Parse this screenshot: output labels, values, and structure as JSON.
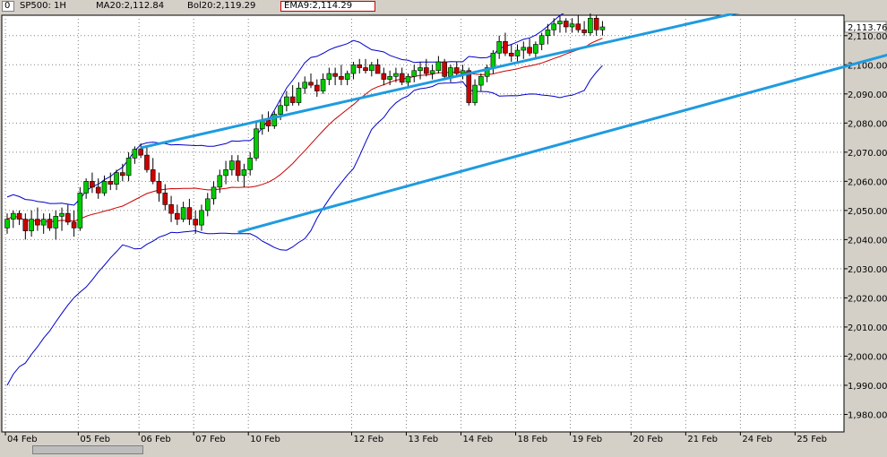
{
  "header": {
    "symbol_box": "0",
    "symbol": "SP500: 1H",
    "ma": "MA20:2,112.84",
    "bol": "Bol20:2,119.29",
    "ema": "EMA9:2,114.29",
    "last_price_label": "2,113.76"
  },
  "colors": {
    "up": "#00cc00",
    "down": "#cc0000",
    "band": "#0000cc",
    "ma": "#cc0000",
    "channel": "#1e9be0",
    "grid": "#808080",
    "bg": "#ffffff",
    "axis_bg": "#d4d0c8"
  },
  "chart_data": {
    "type": "candlestick",
    "title": "",
    "timeframe": "1H",
    "ylim": [
      1974,
      2117
    ],
    "yticks": [
      1980,
      1990,
      2000,
      2010,
      2020,
      2030,
      2040,
      2050,
      2060,
      2070,
      2080,
      2090,
      2100,
      2110
    ],
    "ytick_labels": [
      "1,980.00",
      "1,990.00",
      "2,000.00",
      "2,010.00",
      "2,020.00",
      "2,030.00",
      "2,040.00",
      "2,050.00",
      "2,060.00",
      "2,070.00",
      "2,080.00",
      "2,090.00",
      "2,100.00",
      "2,110.00"
    ],
    "xtick_labels": [
      "04 Feb",
      "05 Feb",
      "06 Feb",
      "07 Feb",
      "10 Feb",
      "12 Feb",
      "13 Feb",
      "14 Feb",
      "18 Feb",
      "19 Feb",
      "20 Feb",
      "21 Feb",
      "24 Feb",
      "25 Feb"
    ],
    "xtick_index": [
      0,
      12,
      22,
      31,
      40,
      57,
      66,
      75,
      84,
      93,
      103,
      112,
      121,
      130
    ],
    "candles": [
      [
        2044,
        2049,
        2042,
        2047
      ],
      [
        2047,
        2050,
        2044,
        2049
      ],
      [
        2049,
        2050,
        2045,
        2047
      ],
      [
        2047,
        2049,
        2040,
        2043
      ],
      [
        2043,
        2050,
        2041,
        2047
      ],
      [
        2047,
        2051,
        2043,
        2045
      ],
      [
        2045,
        2049,
        2042,
        2047
      ],
      [
        2047,
        2049,
        2043,
        2044
      ],
      [
        2044,
        2050,
        2040,
        2048
      ],
      [
        2048,
        2051,
        2043,
        2049
      ],
      [
        2049,
        2052,
        2045,
        2046
      ],
      [
        2046,
        2050,
        2041,
        2044
      ],
      [
        2044,
        2058,
        2043,
        2056
      ],
      [
        2056,
        2061,
        2054,
        2060
      ],
      [
        2060,
        2063,
        2056,
        2058
      ],
      [
        2058,
        2061,
        2054,
        2056
      ],
      [
        2056,
        2062,
        2055,
        2060
      ],
      [
        2060,
        2063,
        2057,
        2059
      ],
      [
        2059,
        2064,
        2057,
        2063
      ],
      [
        2063,
        2066,
        2060,
        2062
      ],
      [
        2062,
        2070,
        2060,
        2068
      ],
      [
        2068,
        2072,
        2066,
        2071
      ],
      [
        2071,
        2073,
        2068,
        2069
      ],
      [
        2069,
        2072,
        2063,
        2064
      ],
      [
        2064,
        2068,
        2059,
        2060
      ],
      [
        2060,
        2063,
        2053,
        2056
      ],
      [
        2056,
        2059,
        2050,
        2052
      ],
      [
        2052,
        2055,
        2046,
        2049
      ],
      [
        2049,
        2052,
        2045,
        2047
      ],
      [
        2047,
        2053,
        2046,
        2051
      ],
      [
        2051,
        2054,
        2045,
        2047
      ],
      [
        2047,
        2050,
        2042,
        2045
      ],
      [
        2045,
        2052,
        2043,
        2050
      ],
      [
        2050,
        2056,
        2048,
        2054
      ],
      [
        2054,
        2060,
        2052,
        2058
      ],
      [
        2058,
        2064,
        2056,
        2062
      ],
      [
        2062,
        2067,
        2059,
        2064
      ],
      [
        2064,
        2069,
        2062,
        2067
      ],
      [
        2067,
        2069,
        2060,
        2062
      ],
      [
        2062,
        2066,
        2058,
        2064
      ],
      [
        2064,
        2070,
        2062,
        2068
      ],
      [
        2068,
        2080,
        2067,
        2078
      ],
      [
        2078,
        2083,
        2076,
        2081
      ],
      [
        2081,
        2084,
        2077,
        2079
      ],
      [
        2079,
        2084,
        2078,
        2083
      ],
      [
        2083,
        2088,
        2081,
        2086
      ],
      [
        2086,
        2091,
        2084,
        2089
      ],
      [
        2089,
        2093,
        2086,
        2087
      ],
      [
        2087,
        2094,
        2086,
        2092
      ],
      [
        2092,
        2096,
        2090,
        2094
      ],
      [
        2094,
        2097,
        2092,
        2093
      ],
      [
        2093,
        2095,
        2089,
        2091
      ],
      [
        2091,
        2097,
        2090,
        2095
      ],
      [
        2095,
        2099,
        2093,
        2097
      ],
      [
        2097,
        2099,
        2093,
        2096
      ],
      [
        2096,
        2100,
        2093,
        2095
      ],
      [
        2095,
        2098,
        2093,
        2097
      ],
      [
        2097,
        2101,
        2095,
        2100
      ],
      [
        2100,
        2102,
        2097,
        2099
      ],
      [
        2099,
        2102,
        2097,
        2098
      ],
      [
        2098,
        2101,
        2096,
        2100
      ],
      [
        2100,
        2102,
        2097,
        2097
      ],
      [
        2097,
        2099,
        2093,
        2095
      ],
      [
        2095,
        2098,
        2093,
        2096
      ],
      [
        2096,
        2099,
        2094,
        2097
      ],
      [
        2097,
        2099,
        2093,
        2094
      ],
      [
        2094,
        2097,
        2092,
        2096
      ],
      [
        2096,
        2100,
        2094,
        2098
      ],
      [
        2098,
        2101,
        2095,
        2099
      ],
      [
        2099,
        2102,
        2096,
        2097
      ],
      [
        2097,
        2100,
        2095,
        2098
      ],
      [
        2098,
        2103,
        2097,
        2101
      ],
      [
        2101,
        2102,
        2095,
        2096
      ],
      [
        2096,
        2100,
        2094,
        2099
      ],
      [
        2099,
        2101,
        2096,
        2097
      ],
      [
        2097,
        2100,
        2095,
        2098
      ],
      [
        2098,
        2099,
        2086,
        2087
      ],
      [
        2087,
        2095,
        2086,
        2093
      ],
      [
        2093,
        2097,
        2091,
        2096
      ],
      [
        2096,
        2100,
        2094,
        2099
      ],
      [
        2099,
        2105,
        2097,
        2104
      ],
      [
        2104,
        2110,
        2102,
        2108
      ],
      [
        2108,
        2111,
        2103,
        2104
      ],
      [
        2104,
        2107,
        2101,
        2103
      ],
      [
        2103,
        2107,
        2101,
        2105
      ],
      [
        2105,
        2108,
        2102,
        2106
      ],
      [
        2106,
        2109,
        2103,
        2104
      ],
      [
        2104,
        2108,
        2102,
        2107
      ],
      [
        2107,
        2111,
        2105,
        2110
      ],
      [
        2110,
        2114,
        2107,
        2112
      ],
      [
        2112,
        2116,
        2110,
        2114
      ],
      [
        2114,
        2117,
        2111,
        2115
      ],
      [
        2115,
        2116,
        2111,
        2113
      ],
      [
        2113,
        2116,
        2111,
        2114
      ],
      [
        2114,
        2117,
        2111,
        2112
      ],
      [
        2112,
        2115,
        2110,
        2111
      ],
      [
        2111,
        2118,
        2110,
        2116
      ],
      [
        2116,
        2117,
        2110,
        2112
      ],
      [
        2112,
        2115,
        2110,
        2113
      ]
    ],
    "channel_top": [
      [
        22,
        2071.5
      ],
      [
        148,
        2131
      ]
    ],
    "channel_bottom": [
      [
        38,
        2042.5
      ],
      [
        153,
        2108
      ]
    ]
  }
}
